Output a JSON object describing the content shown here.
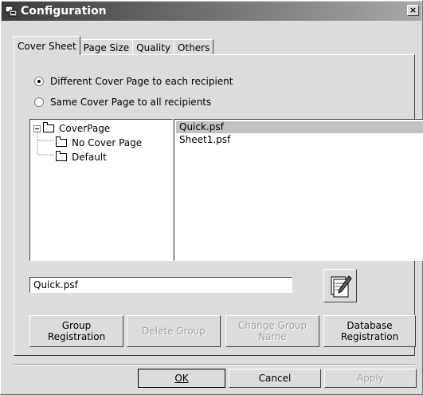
{
  "window": {
    "title": "Configuration",
    "close_label": "×"
  },
  "tabs": [
    {
      "label": "Cover Sheet"
    },
    {
      "label": "Page Size"
    },
    {
      "label": "Quality"
    },
    {
      "label": "Others"
    }
  ],
  "radios": [
    {
      "label": "Different Cover Page to each recipient",
      "checked": true
    },
    {
      "label": "Same Cover Page to all recipients",
      "checked": false
    }
  ],
  "tree": {
    "root": "CoverPage",
    "children": [
      "No Cover Page",
      "Default"
    ]
  },
  "files": [
    {
      "name": "Quick.psf",
      "selected": true
    },
    {
      "name": "Sheet1.psf",
      "selected": false
    }
  ],
  "file_field": {
    "value": "Quick.psf"
  },
  "group_buttons": {
    "group_registration": "Group\nRegistration",
    "delete_group": "Delete Group",
    "change_group_name": "Change Group\nName",
    "database_registration": "Database\nRegistration"
  },
  "dialog_buttons": {
    "ok": "OK",
    "cancel": "Cancel",
    "apply": "Apply"
  },
  "icons": {
    "app": "configuration-icon",
    "edit": "notepad-pencil-icon"
  }
}
